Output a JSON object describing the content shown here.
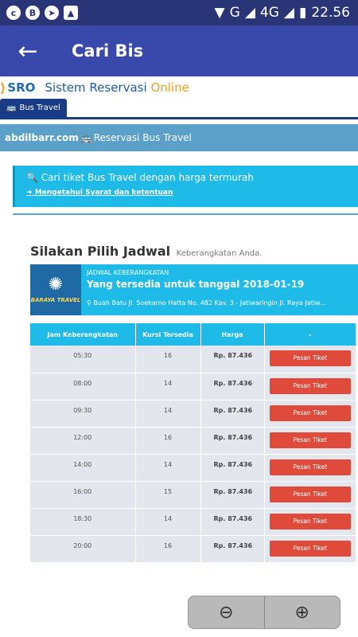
{
  "statusbar": {
    "icons": [
      "notification-c-icon",
      "beetalk-b-icon",
      "telegram-icon",
      "image-icon"
    ],
    "network": "G",
    "network2": "4G",
    "time": "22.56"
  },
  "appbar": {
    "title": "Cari Bis"
  },
  "site": {
    "logo_mark": "SRO",
    "logo_name": "Sistem Reservasi",
    "logo_online": "Online",
    "tab": "Bus Travel",
    "user": "abdilbarr.com",
    "section": "Reservasi Bus Travel"
  },
  "info": {
    "search_text": "Cari tiket Bus Travel dengan harga termurah",
    "terms_link": "Mengetahui Syarat dan ketentuan"
  },
  "schedule": {
    "heading": "Silakan Pilih Jadwal",
    "heading_sub": "Keberangkatan Anda.",
    "operator": "BARAYA TRAVEL",
    "label": "JADWAL KEBERANGKATAN",
    "date_text": "Yang tersedia untuk tanggal 2018-01-19",
    "route": "Buah Batu Jl. Soekarno Hatta No. 482 Kav. 3 -  Jatiwaringin Jl. Raya Jatiw…",
    "columns": [
      "Jam Keberangkatan",
      "Kursi Tersedia",
      "Harga",
      "-"
    ],
    "button_label": "Pesan Tiket",
    "rows": [
      {
        "time": "05:30",
        "seats": "16",
        "price": "Rp. 87.436"
      },
      {
        "time": "08:00",
        "seats": "14",
        "price": "Rp. 87.436"
      },
      {
        "time": "09:30",
        "seats": "14",
        "price": "Rp. 87.436"
      },
      {
        "time": "12:00",
        "seats": "16",
        "price": "Rp. 87.436"
      },
      {
        "time": "14:00",
        "seats": "14",
        "price": "Rp. 87.436"
      },
      {
        "time": "16:00",
        "seats": "15",
        "price": "Rp. 87.436"
      },
      {
        "time": "18:30",
        "seats": "14",
        "price": "Rp. 87.436"
      },
      {
        "time": "20:00",
        "seats": "16",
        "price": "Rp. 87.436"
      }
    ]
  },
  "zoom": {
    "out_icon": "zoom-out-icon",
    "in_icon": "zoom-in-icon"
  },
  "colors": {
    "statusbar": "#2a3577",
    "appbar": "#3948ab",
    "accent": "#1ebbe8",
    "button": "#e04a3a"
  }
}
